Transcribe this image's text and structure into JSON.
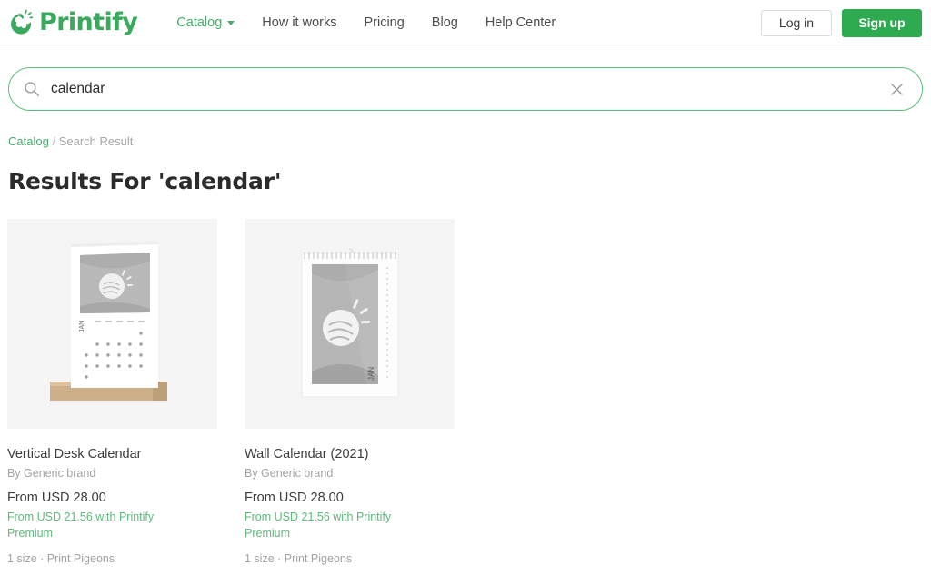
{
  "brand": {
    "name": "Printify",
    "accent_green": "#2eaa51",
    "link_green": "#4aab6c"
  },
  "header": {
    "nav": [
      {
        "label": "Catalog",
        "active": true,
        "has_caret": true
      },
      {
        "label": "How it works",
        "active": false,
        "has_caret": false
      },
      {
        "label": "Pricing",
        "active": false,
        "has_caret": false
      },
      {
        "label": "Blog",
        "active": false,
        "has_caret": false
      },
      {
        "label": "Help Center",
        "active": false,
        "has_caret": false
      }
    ],
    "login_label": "Log in",
    "signup_label": "Sign up"
  },
  "search": {
    "value": "calendar",
    "placeholder": "Search products",
    "icon": "search-icon",
    "clear_icon": "close-icon"
  },
  "breadcrumb": {
    "root": "Catalog",
    "separator": "/",
    "current": "Search Result"
  },
  "page": {
    "title": "Results For 'calendar'"
  },
  "products": [
    {
      "title": "Vertical Desk Calendar",
      "brand": "By Generic brand",
      "price": "From USD 28.00",
      "premium_price": "From USD 21.56 with Printify Premium",
      "meta": "1 size · Print Pigeons",
      "image_kind": "desk-calendar",
      "image_month": "JAN"
    },
    {
      "title": "Wall Calendar (2021)",
      "brand": "By Generic brand",
      "price": "From USD 28.00",
      "premium_price": "From USD 21.56 with Printify Premium",
      "meta": "1 size · Print Pigeons",
      "image_kind": "wall-calendar",
      "image_month": "JAN"
    }
  ]
}
